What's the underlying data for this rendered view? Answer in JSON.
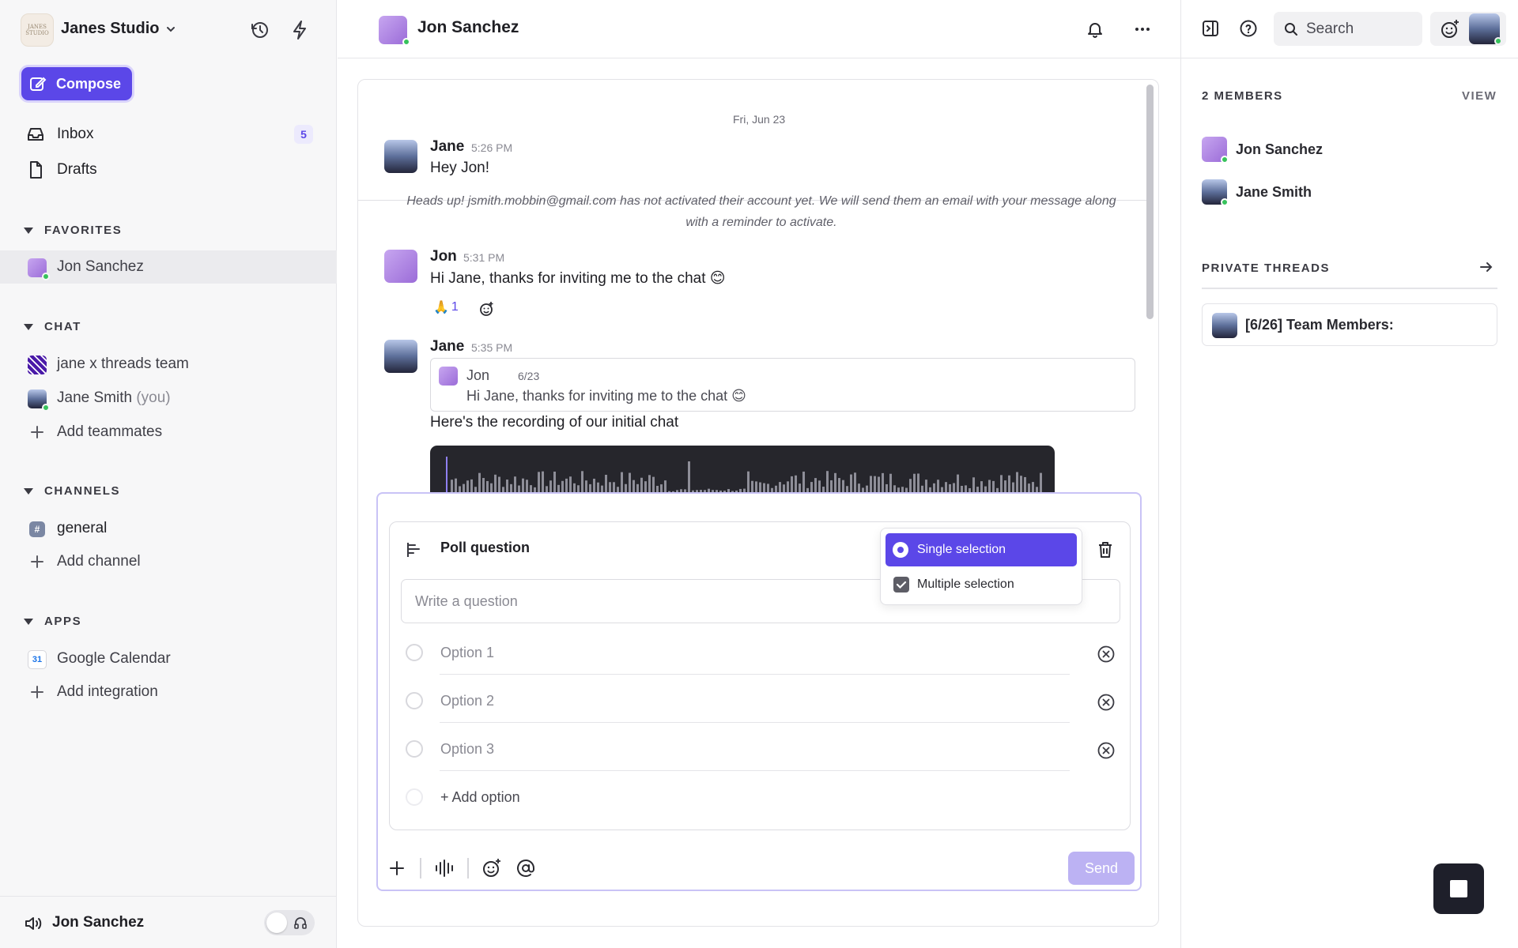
{
  "workspace": {
    "name": "Janes Studio",
    "logo_text": "JANES STUDIO"
  },
  "sidebar": {
    "compose_label": "Compose",
    "inbox": {
      "label": "Inbox",
      "count": "5"
    },
    "drafts_label": "Drafts",
    "favorites": {
      "title": "FAVORITES",
      "items": [
        {
          "label": "Jon Sanchez"
        }
      ]
    },
    "chat": {
      "title": "CHAT",
      "items": [
        {
          "label": "jane x threads team"
        },
        {
          "label": "Jane Smith",
          "suffix": "(you)"
        }
      ],
      "add_label": "Add teammates"
    },
    "channels": {
      "title": "CHANNELS",
      "items": [
        {
          "label": "general"
        }
      ],
      "add_label": "Add channel"
    },
    "apps": {
      "title": "APPS",
      "items": [
        {
          "label": "Google Calendar",
          "icon_text": "31"
        }
      ],
      "add_label": "Add integration"
    },
    "bottom": {
      "name": "Jon Sanchez"
    }
  },
  "header": {
    "title": "Jon Sanchez"
  },
  "chat": {
    "date_divider": "Fri, Jun 23",
    "messages": [
      {
        "author": "Jane",
        "time": "5:26 PM",
        "text": "Hey Jon!"
      },
      {
        "author": "Jon",
        "time": "5:31 PM",
        "text": "Hi Jane, thanks for inviting me to the chat 😊",
        "reaction": {
          "emoji": "🙏",
          "count": "1"
        }
      },
      {
        "author": "Jane",
        "time": "5:35 PM",
        "text": "Here's the recording of our initial chat",
        "quote": {
          "author": "Jon",
          "date": "6/23",
          "text": "Hi Jane, thanks for inviting me to the chat 😊"
        }
      }
    ],
    "notice": "Heads up! jsmith.mobbin@gmail.com has not activated their account yet. We will send them an email with your message along with a reminder to activate."
  },
  "composer": {
    "poll_title": "Poll question",
    "question_placeholder": "Write a question",
    "options": [
      {
        "placeholder": "Option 1"
      },
      {
        "placeholder": "Option 2"
      },
      {
        "placeholder": "Option 3"
      }
    ],
    "add_option_label": "+ Add option",
    "send_label": "Send",
    "selection_menu": [
      {
        "label": "Single selection",
        "selected": true
      },
      {
        "label": "Multiple selection",
        "selected": false
      }
    ]
  },
  "right_panel": {
    "search_placeholder": "Search",
    "members_title": "2 MEMBERS",
    "view_label": "VIEW",
    "members": [
      {
        "name": "Jon Sanchez"
      },
      {
        "name": "Jane Smith"
      }
    ],
    "threads_title": "PRIVATE THREADS",
    "threads": [
      {
        "title": "[6/26] Team Members:"
      }
    ]
  },
  "colors": {
    "accent": "#5b47e8",
    "online": "#37c25c",
    "send_disabled": "#bcb2f3"
  }
}
